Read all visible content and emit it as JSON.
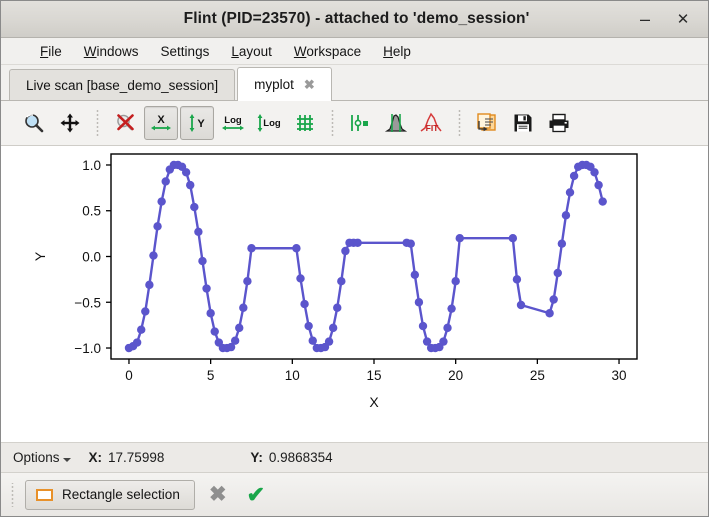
{
  "window": {
    "title": "Flint (PID=23570) - attached to 'demo_session'",
    "minimize_label": "–",
    "close_label": "✕"
  },
  "menubar": {
    "items": [
      {
        "pre": "",
        "mnemonic": "F",
        "post": "ile"
      },
      {
        "pre": "",
        "mnemonic": "W",
        "post": "indows"
      },
      {
        "pre": "",
        "mnemonic": "S",
        "post": "ettings"
      },
      {
        "pre": "",
        "mnemonic": "L",
        "post": "ayout"
      },
      {
        "pre": "",
        "mnemonic": "W",
        "post": "orkspace"
      },
      {
        "pre": "",
        "mnemonic": "H",
        "post": "elp"
      }
    ],
    "labels": [
      "File",
      "Windows",
      "Settings",
      "Layout",
      "Workspace",
      "Help"
    ]
  },
  "tabs": [
    {
      "label": "Live scan [base_demo_session]",
      "active": false,
      "closable": false
    },
    {
      "label": "myplot",
      "active": true,
      "closable": true,
      "close_label": "✖"
    }
  ],
  "toolbar": {
    "buttons": [
      {
        "name": "zoom-icon",
        "tooltip": "Zoom",
        "checked": false
      },
      {
        "name": "pan-icon",
        "tooltip": "Pan",
        "checked": false
      },
      {
        "name": "reset-zoom-icon",
        "tooltip": "Reset zoom",
        "checked": false
      },
      {
        "name": "autoscale-x-icon",
        "tooltip": "Auto scale X",
        "checked": true,
        "label": "X"
      },
      {
        "name": "autoscale-y-icon",
        "tooltip": "Auto scale Y",
        "checked": true,
        "label": "Y"
      },
      {
        "name": "log-x-icon",
        "tooltip": "Logarithmic X",
        "checked": false,
        "label": "Log"
      },
      {
        "name": "log-y-icon",
        "tooltip": "Logarithmic Y",
        "checked": false,
        "label": "Log"
      },
      {
        "name": "grid-icon",
        "tooltip": "Show grid",
        "checked": false
      },
      {
        "name": "markers-icon",
        "tooltip": "Markers",
        "checked": false
      },
      {
        "name": "statistics-icon",
        "tooltip": "Statistics",
        "checked": false
      },
      {
        "name": "curve-fit-icon",
        "tooltip": "Curve fit",
        "checked": false,
        "label": "FIT"
      },
      {
        "name": "copy-icon",
        "tooltip": "Copy",
        "checked": false
      },
      {
        "name": "save-icon",
        "tooltip": "Save",
        "checked": false
      },
      {
        "name": "print-icon",
        "tooltip": "Print",
        "checked": false
      }
    ]
  },
  "statusbar": {
    "options_label": "Options",
    "x_label": "X:",
    "x_value": "17.75998",
    "y_label": "Y:",
    "y_value": "0.9868354"
  },
  "actionbar": {
    "rectangle_selection_label": "Rectangle selection",
    "cancel_label": "✖",
    "confirm_label": "✔"
  },
  "colors": {
    "curve": "#5b55cc",
    "marker": "#5b55cc",
    "axis": "#000000",
    "plot_background": "#ffffff",
    "accent_orange": "#e8912a",
    "accent_green": "#19a64a",
    "toolbar_green": "#1aa64b",
    "toolbar_red": "#cc2222"
  },
  "chart_data": {
    "type": "line",
    "title": "",
    "xlabel": "X",
    "ylabel": "Y",
    "xlim": [
      -1.1,
      31.1
    ],
    "ylim": [
      -1.12,
      1.12
    ],
    "xticks": [
      0,
      5,
      10,
      15,
      20,
      25,
      30
    ],
    "xtick_labels": [
      "0",
      "5",
      "10",
      "15",
      "20",
      "25",
      "30"
    ],
    "yticks": [
      -1.0,
      -0.5,
      0.0,
      0.5,
      1.0
    ],
    "ytick_labels": [
      "−1.0",
      "−0.5",
      "0.0",
      "0.5",
      "1.0"
    ],
    "grid": false,
    "legend": null,
    "marker": "circle",
    "marker_size": 7,
    "line_width": 2.4,
    "series": [
      {
        "name": "myplot",
        "color": "#5b55cc",
        "x": [
          0.0,
          0.25,
          0.5,
          0.75,
          1.0,
          1.25,
          1.5,
          1.75,
          2.0,
          2.25,
          2.5,
          2.75,
          3.0,
          3.25,
          3.5,
          3.75,
          4.0,
          4.25,
          4.5,
          4.75,
          5.0,
          5.25,
          5.5,
          5.75,
          6.0,
          6.25,
          6.5,
          6.75,
          7.0,
          7.25,
          7.5,
          10.25,
          10.5,
          10.75,
          11.0,
          11.25,
          11.5,
          11.75,
          12.0,
          12.25,
          12.5,
          12.75,
          13.0,
          13.25,
          13.5,
          13.75,
          14.0,
          17.0,
          17.25,
          17.5,
          17.75,
          18.0,
          18.25,
          18.5,
          18.75,
          19.0,
          19.25,
          19.5,
          19.75,
          20.0,
          20.25,
          23.5,
          23.75,
          24.0,
          25.75,
          26.0,
          26.25,
          26.5,
          26.75,
          27.0,
          27.25,
          27.5,
          27.75,
          28.0,
          28.25,
          28.5,
          28.75,
          29.0
        ],
        "y": [
          -1.0,
          -0.98,
          -0.94,
          -0.8,
          -0.6,
          -0.31,
          0.01,
          0.33,
          0.6,
          0.82,
          0.95,
          1.0,
          1.0,
          0.98,
          0.92,
          0.78,
          0.54,
          0.27,
          -0.05,
          -0.35,
          -0.62,
          -0.82,
          -0.94,
          -1.0,
          -1.0,
          -0.99,
          -0.92,
          -0.78,
          -0.56,
          -0.27,
          0.09,
          0.09,
          -0.24,
          -0.52,
          -0.76,
          -0.92,
          -1.0,
          -1.0,
          -0.99,
          -0.93,
          -0.78,
          -0.56,
          -0.27,
          0.06,
          0.15,
          0.15,
          0.15,
          0.15,
          0.14,
          -0.2,
          -0.5,
          -0.76,
          -0.93,
          -1.0,
          -1.0,
          -0.99,
          -0.93,
          -0.78,
          -0.57,
          -0.27,
          0.2,
          0.2,
          -0.25,
          -0.53,
          -0.62,
          -0.47,
          -0.18,
          0.14,
          0.45,
          0.7,
          0.88,
          0.98,
          1.0,
          1.0,
          0.98,
          0.92,
          0.78,
          0.6
        ]
      }
    ]
  }
}
